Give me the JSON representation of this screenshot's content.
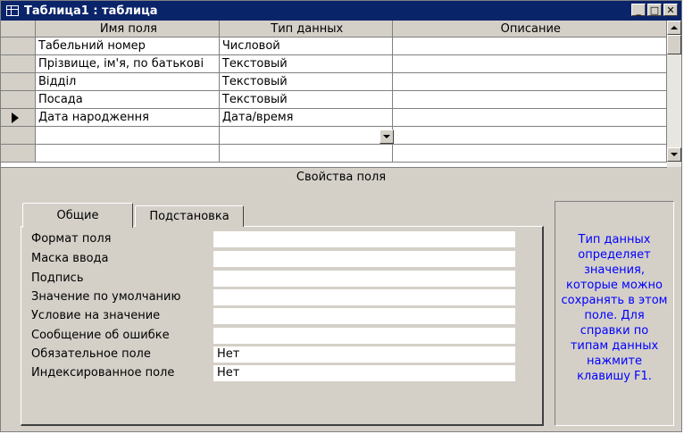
{
  "window": {
    "title": "Таблица1 : таблица",
    "buttons": {
      "minimize": "_",
      "maximize": "□",
      "close": "✕"
    }
  },
  "grid": {
    "headers": {
      "field_name": "Имя поля",
      "data_type": "Тип данных",
      "description": "Описание"
    },
    "rows": [
      {
        "field_name": "Табельний номер",
        "data_type": "Числовой",
        "description": ""
      },
      {
        "field_name": "Прізвище, ім'я, по батькові",
        "data_type": "Текстовый",
        "description": ""
      },
      {
        "field_name": "Відділ",
        "data_type": "Текстовый",
        "description": ""
      },
      {
        "field_name": "Посада",
        "data_type": "Текстовый",
        "description": ""
      },
      {
        "field_name": "Дата народження",
        "data_type": "Дата/время",
        "description": ""
      }
    ]
  },
  "properties": {
    "header": "Свойства поля",
    "tabs": {
      "general": "Общие",
      "lookup": "Подстановка"
    },
    "fields": [
      {
        "label": "Формат поля",
        "value": ""
      },
      {
        "label": "Маска ввода",
        "value": ""
      },
      {
        "label": "Подпись",
        "value": ""
      },
      {
        "label": "Значение по умолчанию",
        "value": ""
      },
      {
        "label": "Условие на значение",
        "value": ""
      },
      {
        "label": "Сообщение об ошибке",
        "value": ""
      },
      {
        "label": "Обязательное поле",
        "value": "Нет"
      },
      {
        "label": "Индексированное поле",
        "value": "Нет"
      }
    ],
    "help_text": "Тип данных определяет значения, которые можно сохранять в этом поле.  Для справки по типам данных нажмите клавишу F1."
  },
  "colors": {
    "titlebar": "#0a246a",
    "help_text": "#0000ff",
    "face": "#d4d0c8"
  }
}
